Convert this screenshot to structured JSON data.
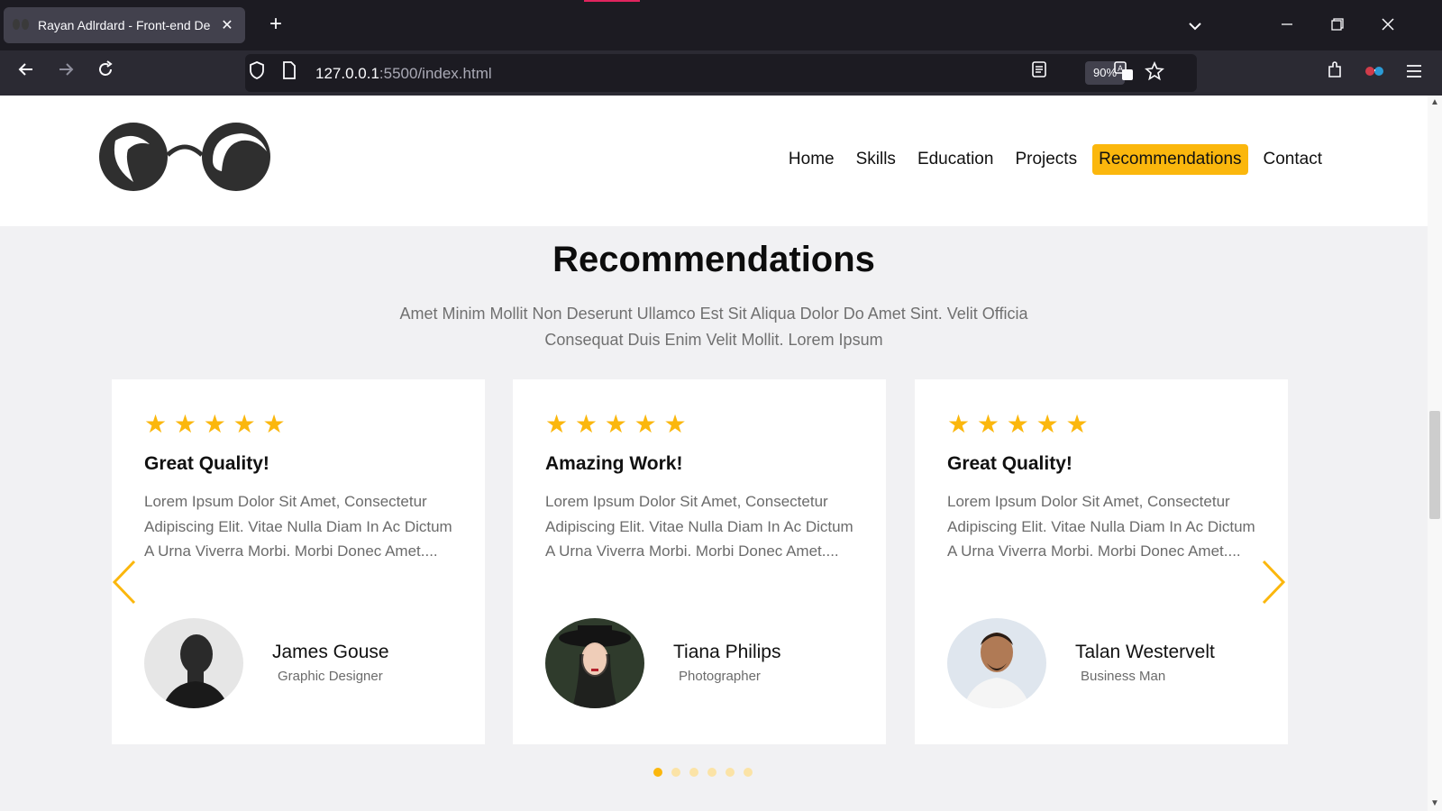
{
  "browser": {
    "tab_title": "Rayan Adlrdard - Front-end De",
    "tab_close": "✕",
    "new_tab": "+",
    "url_host": "127.0.0.1",
    "url_path": ":5500/index.html",
    "zoom": "90%",
    "icons": [
      "back-icon",
      "forward-icon",
      "reload-icon",
      "shield-icon",
      "page-icon",
      "reader-view-icon",
      "translate-icon",
      "bookmark-star-icon",
      "extensions-icon",
      "profile-icon",
      "menu-icon"
    ]
  },
  "nav": {
    "items": [
      {
        "label": "Home"
      },
      {
        "label": "Skills"
      },
      {
        "label": "Education"
      },
      {
        "label": "Projects"
      },
      {
        "label": "Recommendations"
      },
      {
        "label": "Contact"
      }
    ],
    "active": "Recommendations"
  },
  "section": {
    "title": "Recommendations",
    "subtitle": "Amet Minim Mollit Non Deserunt Ullamco Est Sit Aliqua Dolor Do Amet Sint. Velit Officia Consequat Duis Enim Velit Mollit. Lorem Ipsum"
  },
  "cards": [
    {
      "rating": "★ ★ ★ ★ ★",
      "title": "Great Quality!",
      "text": "Lorem Ipsum Dolor Sit Amet, Consectetur Adipiscing Elit. Vitae Nulla Diam In Ac Dictum A Urna Viverra Morbi. Morbi Donec Amet....",
      "name": "James Gouse",
      "role": "Graphic Designer"
    },
    {
      "rating": "★ ★ ★ ★ ★",
      "title": "Amazing Work!",
      "text": "Lorem Ipsum Dolor Sit Amet, Consectetur Adipiscing Elit. Vitae Nulla Diam In Ac Dictum A Urna Viverra Morbi. Morbi Donec Amet....",
      "name": "Tiana Philips",
      "role": "Photographer"
    },
    {
      "rating": "★ ★ ★ ★ ★",
      "title": "Great Quality!",
      "text": "Lorem Ipsum Dolor Sit Amet, Consectetur Adipiscing Elit. Vitae Nulla Diam In Ac Dictum A Urna Viverra Morbi. Morbi Donec Amet....",
      "name": "Talan Westervelt",
      "role": "Business Man"
    }
  ],
  "carousel": {
    "page_count": 6,
    "active_page": 1
  },
  "colors": {
    "accent": "#fbb70d",
    "page_bg": "#f1f1f3",
    "card_bg": "#ffffff"
  }
}
